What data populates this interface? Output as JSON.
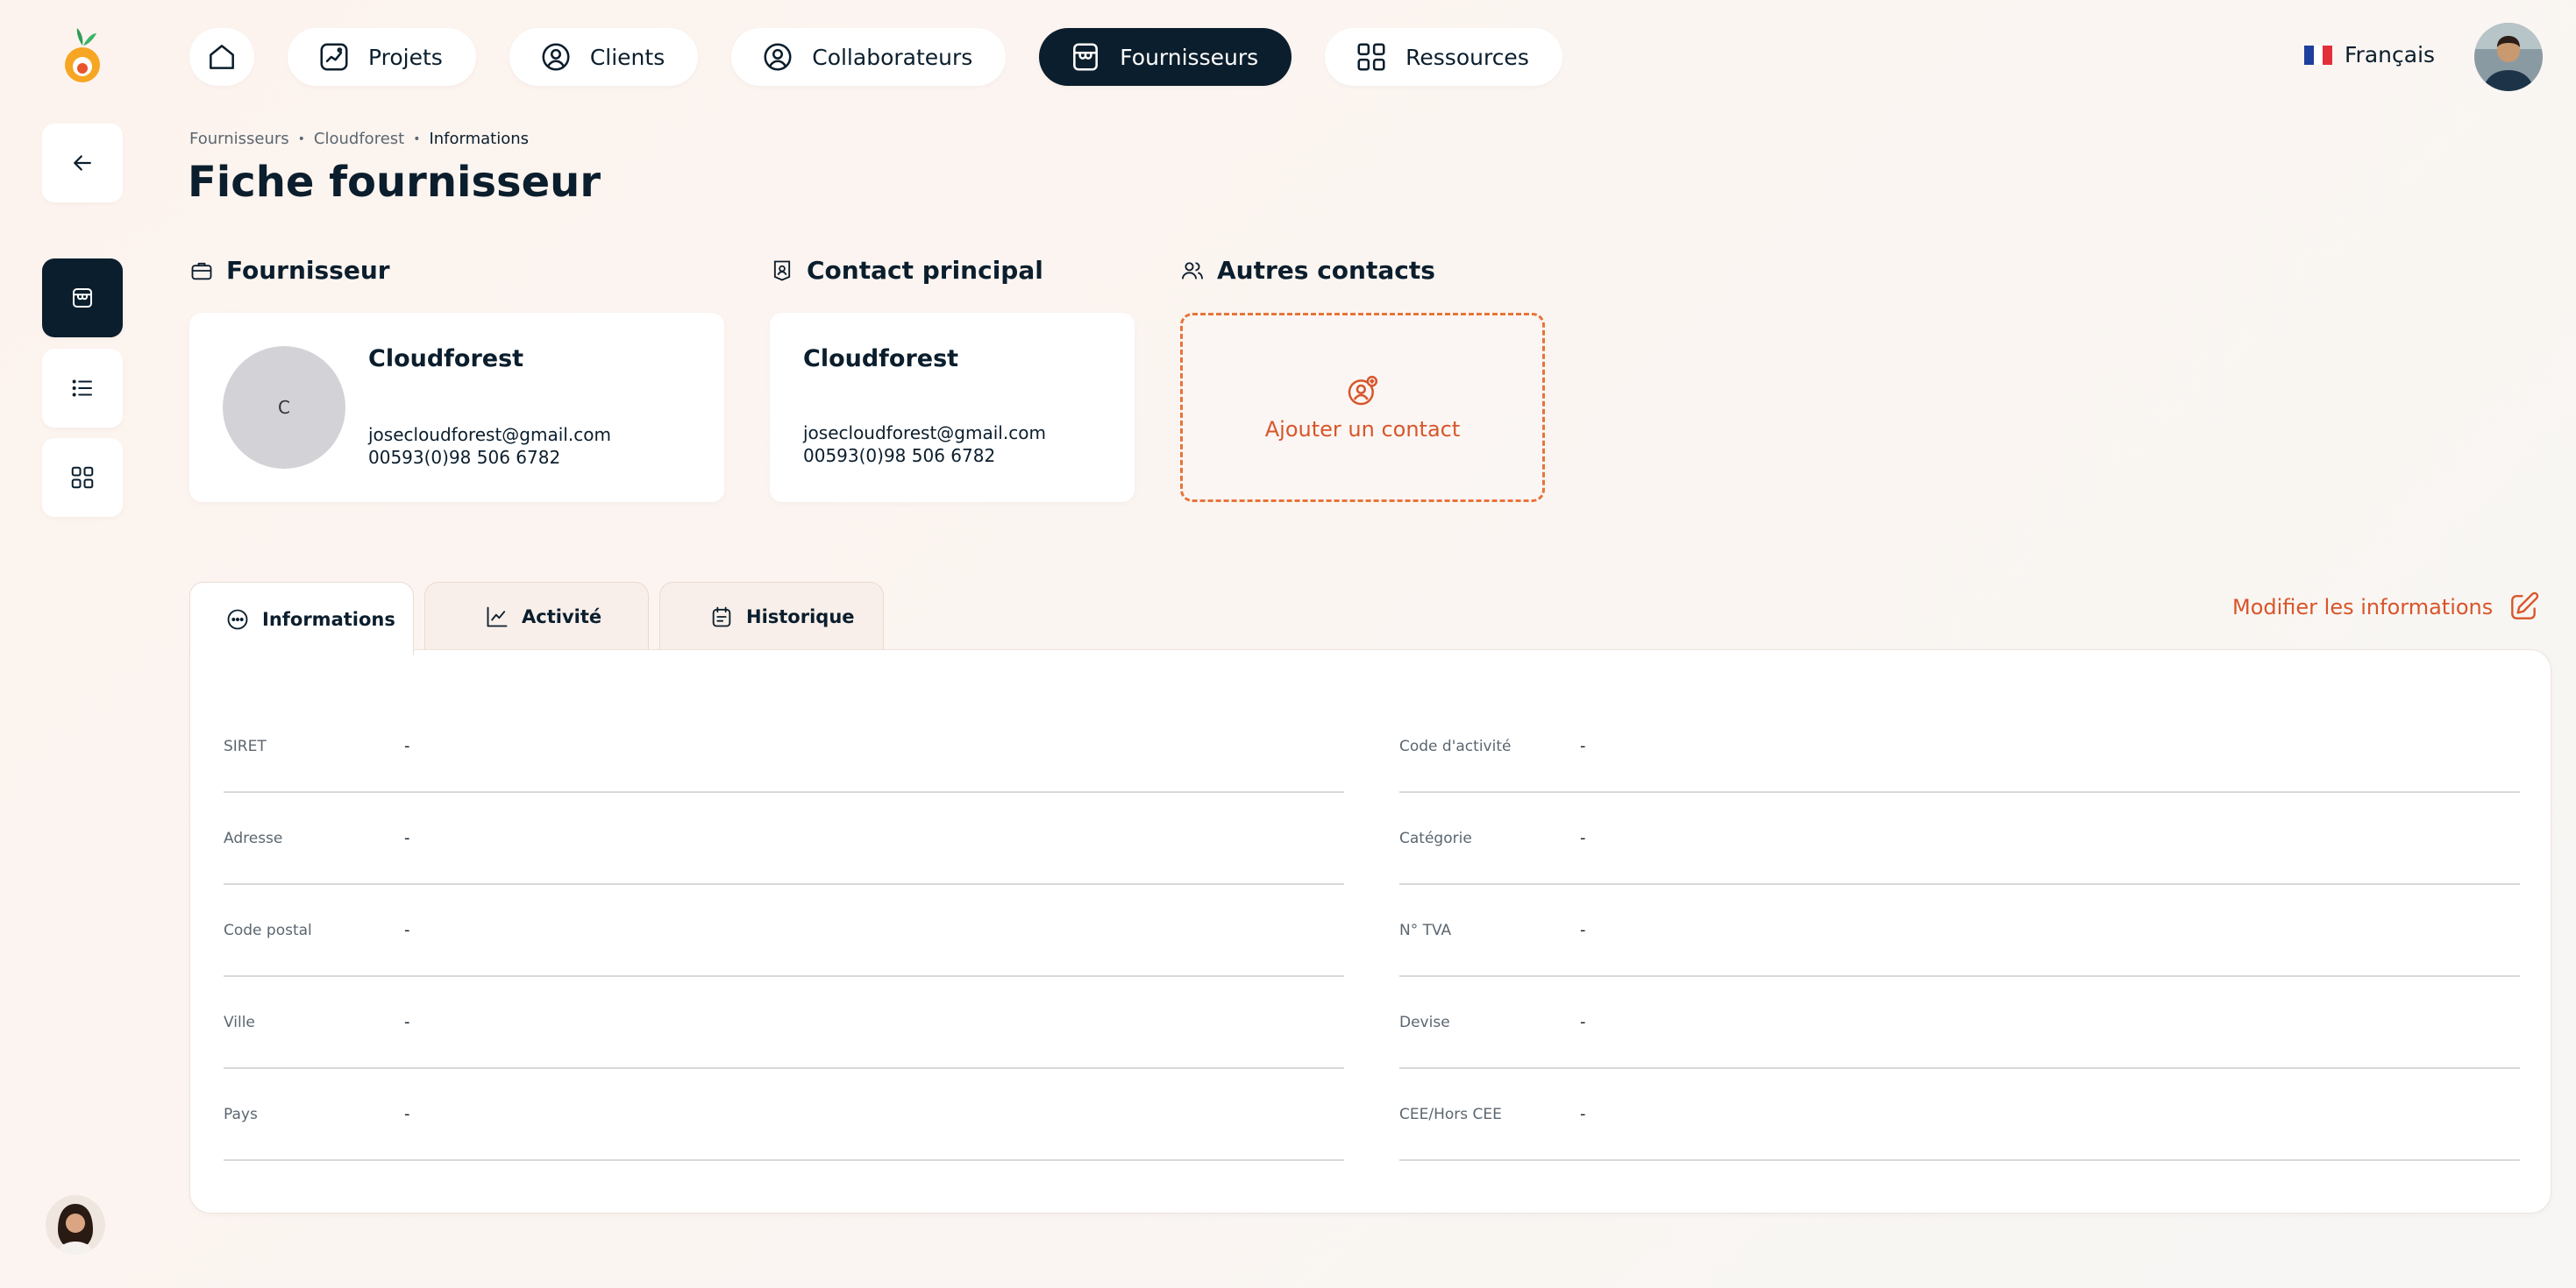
{
  "nav": {
    "items": [
      {
        "label": "Projets"
      },
      {
        "label": "Clients"
      },
      {
        "label": "Collaborateurs"
      },
      {
        "label": "Fournisseurs"
      },
      {
        "label": "Ressources"
      }
    ],
    "active": "Fournisseurs",
    "language": "Français"
  },
  "breadcrumb": [
    "Fournisseurs",
    "Cloudforest",
    "Informations"
  ],
  "page_title": "Fiche fournisseur",
  "sections": {
    "supplier": "Fournisseur",
    "main_contact": "Contact principal",
    "other_contacts": "Autres contacts"
  },
  "supplier": {
    "initial": "C",
    "name": "Cloudforest",
    "email": "josecloudforest@gmail.com",
    "phone": "00593(0)98 506 6782"
  },
  "main_contact": {
    "name": "Cloudforest",
    "email": "josecloudforest@gmail.com",
    "phone": "00593(0)98 506 6782"
  },
  "add_contact_label": "Ajouter un contact",
  "tabs": [
    {
      "label": "Informations"
    },
    {
      "label": "Activité"
    },
    {
      "label": "Historique"
    }
  ],
  "edit_label": "Modifier les informations",
  "fields_left": [
    {
      "label": "SIRET",
      "value": "-"
    },
    {
      "label": "Adresse",
      "value": "-"
    },
    {
      "label": "Code postal",
      "value": "-"
    },
    {
      "label": "Ville",
      "value": "-"
    },
    {
      "label": "Pays",
      "value": "-"
    }
  ],
  "fields_right": [
    {
      "label": "Code d'activité",
      "value": "-"
    },
    {
      "label": "Catégorie",
      "value": "-"
    },
    {
      "label": "N° TVA",
      "value": "-"
    },
    {
      "label": "Devise",
      "value": "-"
    },
    {
      "label": "CEE/Hors CEE",
      "value": "-"
    }
  ],
  "colors": {
    "accent": "#d8552a",
    "dark": "#0b1e2d"
  }
}
